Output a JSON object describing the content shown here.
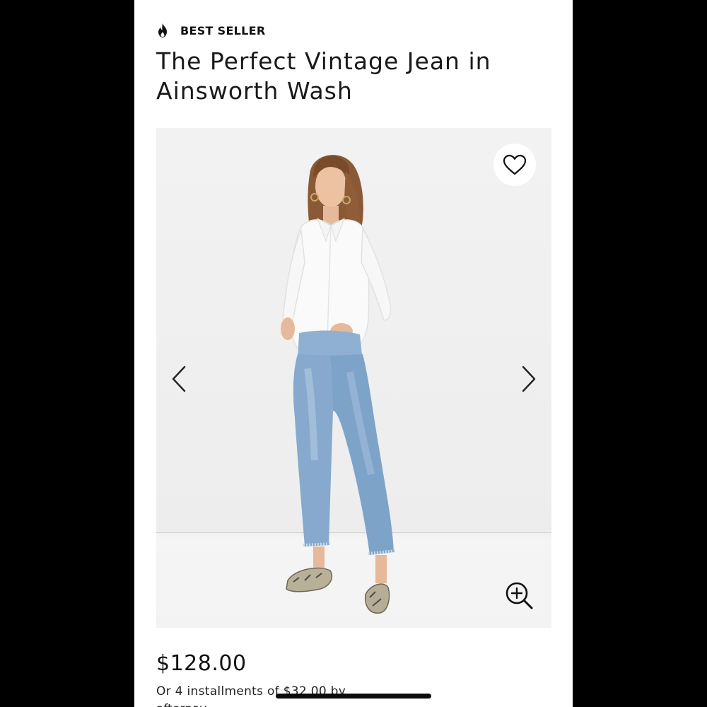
{
  "badge": {
    "icon": "flame-icon",
    "label": "BEST SELLER"
  },
  "product": {
    "title": "The Perfect Vintage Jean in Ainsworth Wash",
    "price": "$128.00",
    "installments_text": "Or 4 installments of $32.00 by",
    "installments_provider_partial": "afterpay"
  },
  "gallery": {
    "image_alt": "Model wearing white button-up shirt and light wash cropped straight jeans with snakeskin flats",
    "wishlist_icon": "heart-icon",
    "prev_icon": "chevron-left-icon",
    "next_icon": "chevron-right-icon",
    "zoom_icon": "zoom-in-icon"
  },
  "colors": {
    "text": "#111111",
    "background": "#ffffff",
    "gallery_bg": "#f2f2f2",
    "denim": "#7fa3c8"
  }
}
